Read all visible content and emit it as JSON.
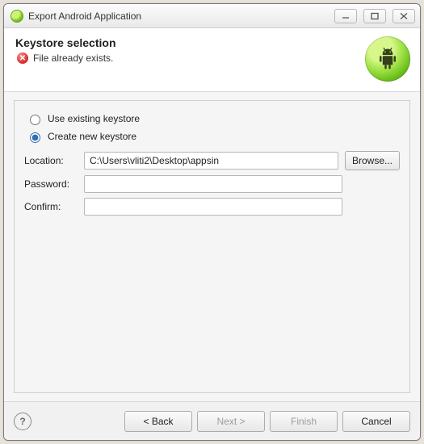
{
  "window": {
    "title": "Export Android Application"
  },
  "banner": {
    "heading": "Keystore selection",
    "status_text": "File already exists."
  },
  "radios": {
    "use_existing": "Use existing keystore",
    "create_new": "Create new keystore",
    "selected": "create_new"
  },
  "form": {
    "location_label": "Location:",
    "location_value": "C:\\Users\\vliti2\\Desktop\\appsin",
    "browse_label": "Browse...",
    "password_label": "Password:",
    "password_value": "",
    "confirm_label": "Confirm:",
    "confirm_value": ""
  },
  "footer": {
    "help": "?",
    "back": "<  Back",
    "next": "Next  >",
    "finish": "Finish",
    "cancel": "Cancel"
  }
}
